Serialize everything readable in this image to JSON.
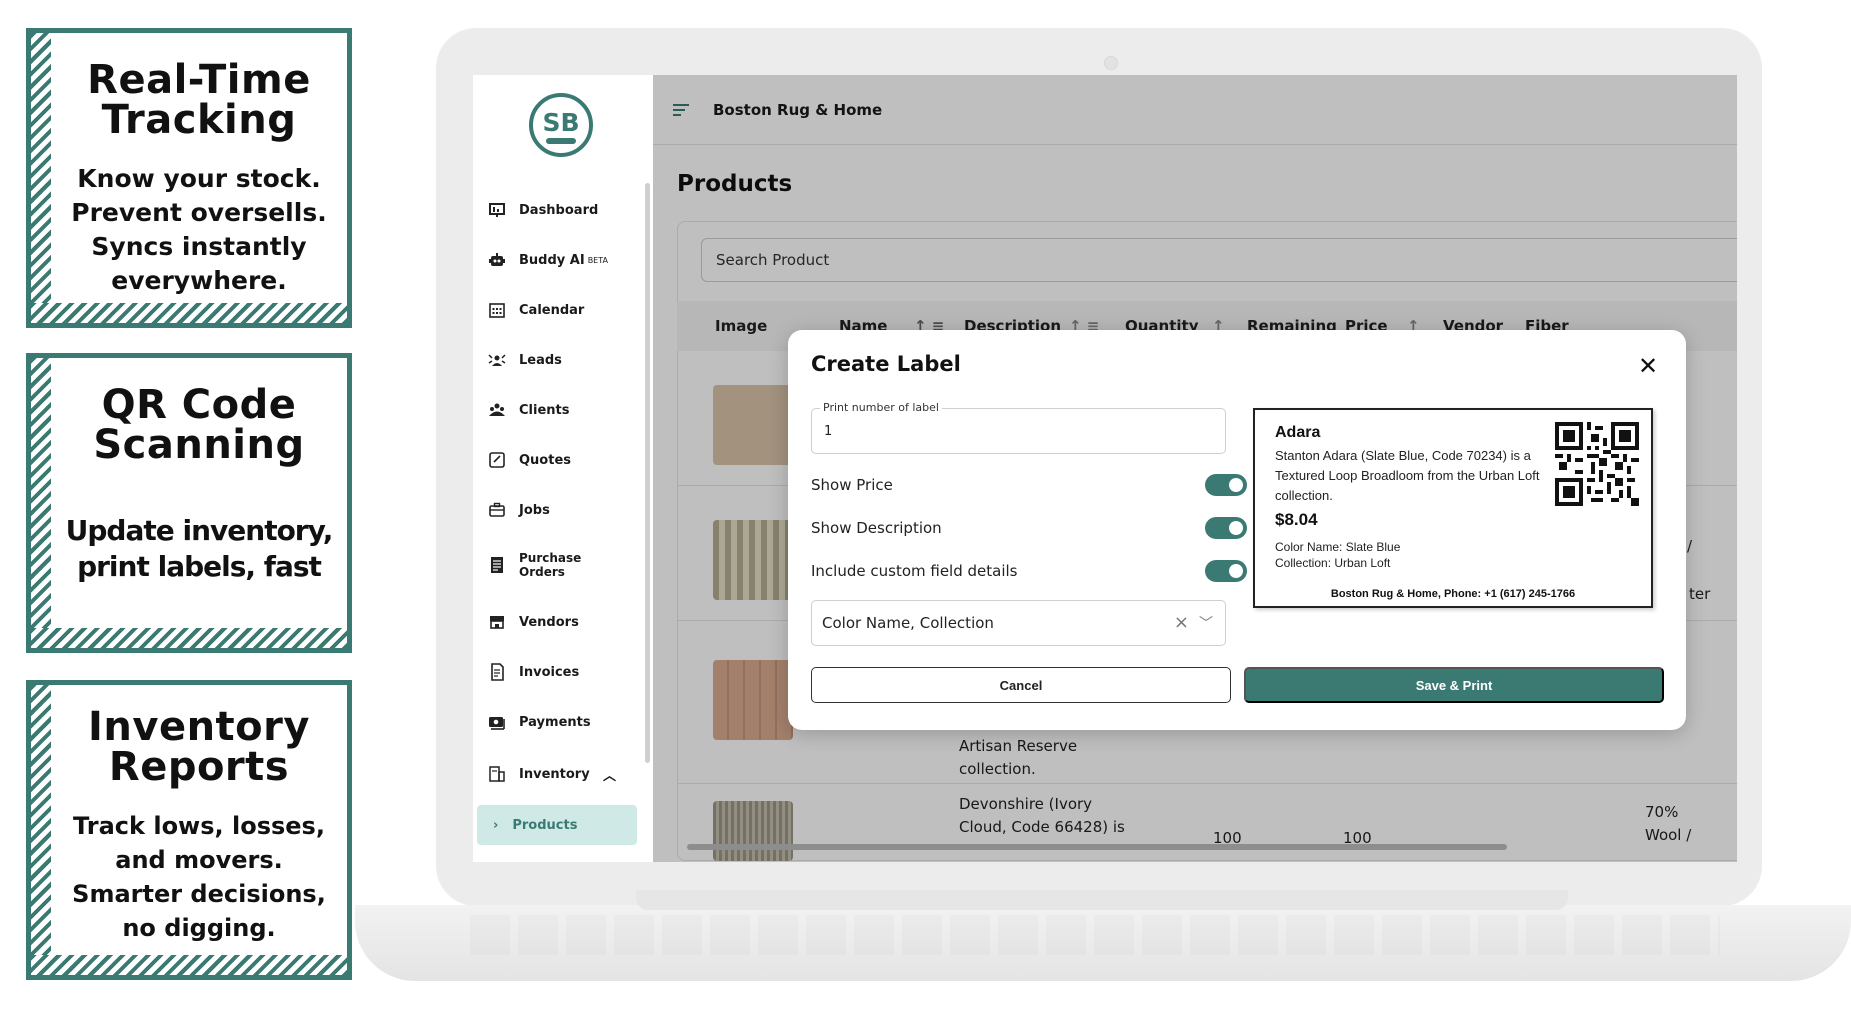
{
  "promo_cards": [
    {
      "title": [
        "Real-Time",
        "Tracking"
      ],
      "body": [
        "Know your stock.",
        "Prevent oversells.",
        "Syncs instantly",
        "everywhere."
      ]
    },
    {
      "title": [
        "QR Code",
        "Scanning"
      ],
      "body": [
        "Update inventory,",
        "print labels, fast"
      ]
    },
    {
      "title": [
        "Inventory",
        "Reports"
      ],
      "body": [
        "Track lows, losses,",
        "and movers.",
        "Smarter decisions,",
        "no digging."
      ]
    }
  ],
  "app": {
    "logo_text": "SB",
    "org_name": "Boston Rug & Home",
    "page_title": "Products",
    "search_placeholder": "Search Product"
  },
  "sidebar": {
    "items": [
      {
        "label": "Dashboard",
        "icon": "dashboard-icon"
      },
      {
        "label": "Buddy AI",
        "badge": "BETA",
        "icon": "robot-icon"
      },
      {
        "label": "Calendar",
        "icon": "calendar-icon"
      },
      {
        "label": "Leads",
        "icon": "leads-icon"
      },
      {
        "label": "Clients",
        "icon": "clients-icon"
      },
      {
        "label": "Quotes",
        "icon": "quotes-icon"
      },
      {
        "label": "Jobs",
        "icon": "briefcase-icon"
      },
      {
        "label_lines": [
          "Purchase",
          "Orders"
        ],
        "icon": "purchase-orders-icon"
      },
      {
        "label": "Vendors",
        "icon": "vendors-icon"
      },
      {
        "label": "Invoices",
        "icon": "invoice-icon"
      },
      {
        "label": "Payments",
        "icon": "payments-icon"
      },
      {
        "label": "Inventory",
        "icon": "inventory-icon",
        "expanded": true
      }
    ],
    "active_subitem": "Products"
  },
  "table": {
    "columns": [
      "Image",
      "Name",
      "Description",
      "Quantity",
      "Remaining",
      "Price",
      "Vendor",
      "Fiber"
    ],
    "visible_fragments": {
      "row3_desc": [
        "Artisan Reserve",
        "collection."
      ],
      "row4_desc": [
        "Devonshire (Ivory",
        "Cloud, Code 66428) is"
      ],
      "row4_quantity": "100",
      "row4_remaining": "100",
      "row4_fiber": [
        "70%",
        "Wool /"
      ],
      "row2_fiber_partial": "ter"
    }
  },
  "modal": {
    "title": "Create Label",
    "print_number_label": "Print number of label",
    "print_number_value": "1",
    "toggles": [
      {
        "label": "Show Price",
        "on": true
      },
      {
        "label": "Show Description",
        "on": true
      },
      {
        "label": "Include custom field details",
        "on": true
      }
    ],
    "custom_fields_value": "Color Name, Collection",
    "cancel_label": "Cancel",
    "save_label": "Save & Print"
  },
  "label_preview": {
    "name": "Adara",
    "description": "Stanton Adara (Slate Blue, Code 70234) is a Textured Loop Broadloom from the Urban Loft collection.",
    "price": "$8.04",
    "color_name": "Color Name: Slate Blue",
    "collection": "Collection: Urban Loft",
    "footer": "Boston Rug & Home, Phone: +1 (617) 245-1766"
  },
  "colors": {
    "brand": "#3b7a73",
    "active_nav_bg": "#cfeae6"
  }
}
